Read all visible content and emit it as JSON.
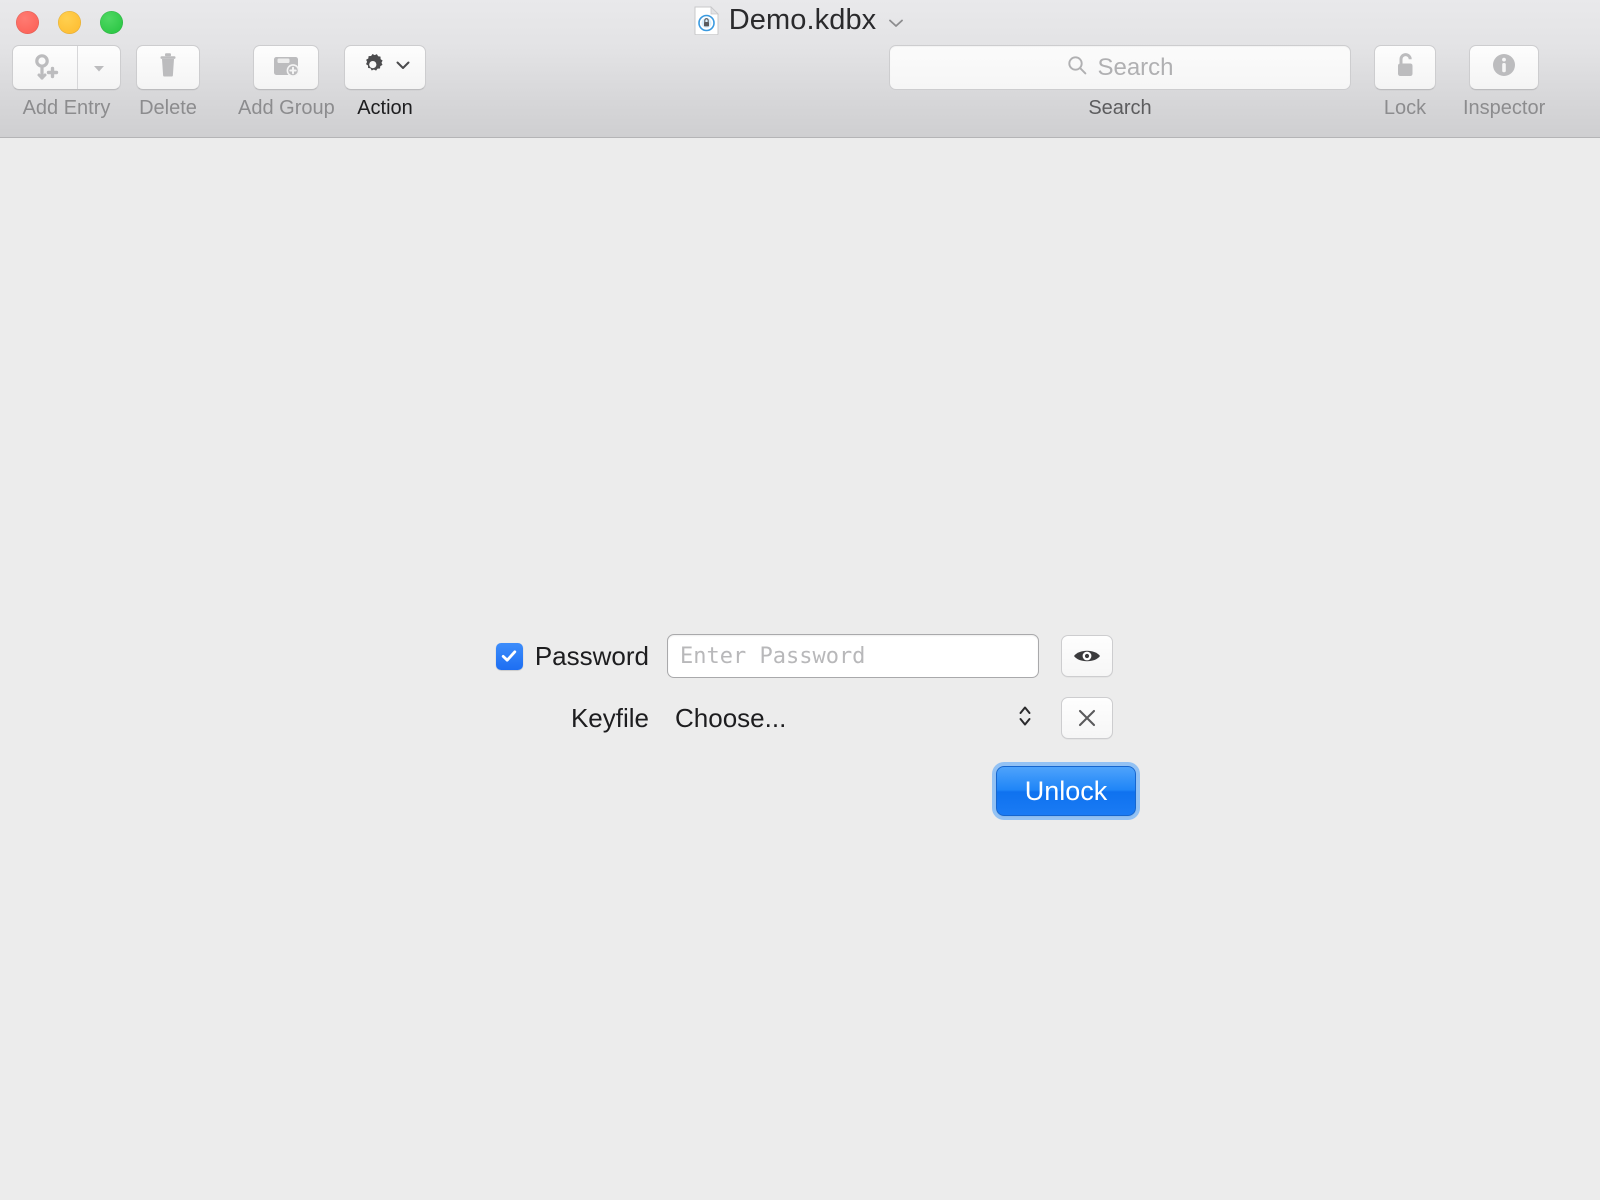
{
  "window": {
    "traffic_lights": [
      {
        "name": "close",
        "color": "#fb5c52"
      },
      {
        "name": "minimize",
        "color": "#feb92c"
      },
      {
        "name": "zoom",
        "color": "#23c23d"
      }
    ],
    "document_title": "Demo.kdbx",
    "document_icon": "locked-document-icon",
    "title_menu_icon": "chevron-down-icon"
  },
  "toolbar": {
    "items": [
      {
        "id": "add-entry",
        "label": "Add Entry",
        "icon": "key-plus-icon",
        "enabled": false,
        "has_dropdown": true
      },
      {
        "id": "delete",
        "label": "Delete",
        "icon": "trash-icon",
        "enabled": false,
        "has_dropdown": false
      },
      {
        "id": "add-group",
        "label": "Add Group",
        "icon": "folder-plus-icon",
        "enabled": false,
        "has_dropdown": false
      },
      {
        "id": "action",
        "label": "Action",
        "icon": "gear-icon",
        "enabled": true,
        "has_dropdown": true
      }
    ],
    "search": {
      "label": "Search",
      "placeholder": "Search",
      "value": "",
      "icon": "search-icon"
    },
    "right_items": [
      {
        "id": "lock",
        "label": "Lock",
        "icon": "unlocked-padlock-icon",
        "enabled": false
      },
      {
        "id": "inspector",
        "label": "Inspector",
        "icon": "info-circle-icon",
        "enabled": false
      }
    ]
  },
  "unlock_form": {
    "password": {
      "checkbox_label": "Password",
      "checkbox_checked": true,
      "placeholder": "Enter Password",
      "value": "",
      "reveal_icon": "eye-icon"
    },
    "keyfile": {
      "label": "Keyfile",
      "selected_option": "Choose...",
      "stepper_icon": "up-down-chevron-icon",
      "clear_icon": "close-x-icon"
    },
    "unlock_button": {
      "label": "Unlock",
      "is_default": true,
      "color": "#1f85f7"
    }
  },
  "colors": {
    "window_background": "#ececec",
    "toolbar_top": "#e9e9eb",
    "toolbar_bottom": "#cfcfd1",
    "accent_blue": "#1f85f7",
    "disabled_text": "#8c8c8e",
    "enabled_text": "#1d1d1f"
  }
}
